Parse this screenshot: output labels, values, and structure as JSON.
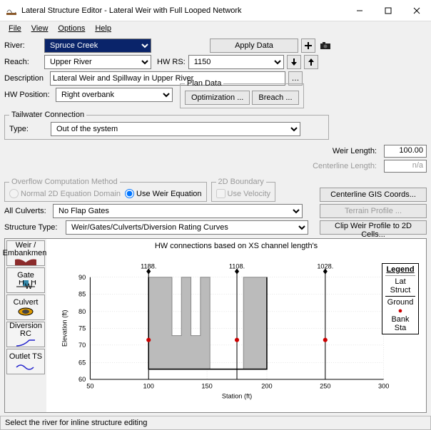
{
  "window": {
    "title": "Lateral Structure Editor - Lateral Weir with Full Looped Network",
    "min": "—",
    "max": "☐",
    "close": "✕"
  },
  "menu": {
    "file": "File",
    "view": "View",
    "options": "Options",
    "help": "Help"
  },
  "form": {
    "river_lbl": "River:",
    "river": "Spruce Creek",
    "apply": "Apply Data",
    "reach_lbl": "Reach:",
    "reach": "Upper River",
    "hwrs_lbl": "HW RS:",
    "hwrs": "1150",
    "desc_lbl": "Description",
    "desc": "Lateral Weir and Spillway in Upper River",
    "hwpos_lbl": "HW Position:",
    "hwpos": "Right overbank",
    "plan_legend": "Plan Data",
    "optimization": "Optimization ...",
    "breach": "Breach ...",
    "tailwater_legend": "Tailwater Connection",
    "type_lbl": "Type:",
    "type": "Out of the system",
    "weirlen_lbl": "Weir Length:",
    "weirlen": "100.00",
    "centlen_lbl": "Centerline Length:",
    "centlen": "n/a",
    "overflow_legend": "Overflow Computation Method",
    "opt_normal": "Normal 2D Equation Domain",
    "opt_weir": "Use Weir Equation",
    "bound2d_legend": "2D Boundary",
    "usevel": "Use Velocity",
    "gis": "Centerline GIS Coords...",
    "culv_lbl": "All Culverts:",
    "culv": "No Flap Gates",
    "terrain": "Terrain Profile ...",
    "stype_lbl": "Structure Type:",
    "stype": "Weir/Gates/Culverts/Diversion Rating Curves",
    "clip": "Clip Weir Profile to 2D Cells..."
  },
  "side": {
    "weir": "Weir / Embankment",
    "gate": "Gate",
    "culvert": "Culvert",
    "div": "Diversion RC",
    "outlet": "Outlet TS"
  },
  "plot": {
    "title": "HW connections based on XS channel length's",
    "xlabel": "Station (ft)",
    "ylabel": "Elevation (ft)",
    "legend_title": "Legend",
    "leg1": "Lat Struct",
    "leg2": "Ground",
    "leg3": "Bank Sta",
    "labels": [
      "1188.",
      "1108.",
      "1028."
    ]
  },
  "status": "Select the river for inline structure editing",
  "chart_data": {
    "type": "line",
    "title": "HW connections based on XS channel length's",
    "xlabel": "Station (ft)",
    "ylabel": "Elevation (ft)",
    "xlim": [
      50,
      300
    ],
    "ylim": [
      60,
      90
    ],
    "xticks": [
      50,
      100,
      150,
      200,
      250,
      300
    ],
    "yticks": [
      60,
      65,
      70,
      75,
      80,
      85,
      90
    ],
    "series": [
      {
        "name": "Lat Struct",
        "x": [
          100,
          100,
          120,
          120,
          128,
          128,
          136,
          136,
          144,
          144,
          152,
          152,
          180,
          180,
          200,
          200,
          200
        ],
        "y": [
          63,
          90,
          90,
          73,
          73,
          90,
          90,
          73,
          73,
          90,
          90,
          63,
          63,
          90,
          90,
          63,
          63
        ],
        "color": "#999",
        "fill": true
      },
      {
        "name": "Ground",
        "x": [
          100,
          100,
          200,
          200
        ],
        "y": [
          90,
          63,
          63,
          90
        ],
        "color": "#000"
      },
      {
        "name": "Bank Sta",
        "type": "scatter",
        "x": [
          100,
          175,
          250
        ],
        "y": [
          72,
          72,
          72
        ],
        "color": "#c00"
      }
    ],
    "annotations": [
      {
        "x": 100,
        "y": 92,
        "text": "1188."
      },
      {
        "x": 175,
        "y": 92,
        "text": "1108."
      },
      {
        "x": 250,
        "y": 92,
        "text": "1028."
      }
    ],
    "vlines": [
      {
        "x": 100
      },
      {
        "x": 175
      },
      {
        "x": 250
      }
    ]
  }
}
